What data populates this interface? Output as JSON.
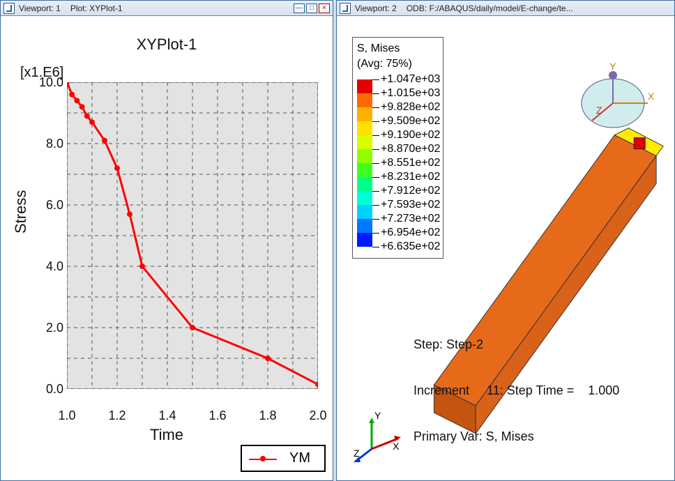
{
  "viewport1": {
    "title_label": "Viewport: 1",
    "title_extra_label": "Plot:",
    "title_extra_value": "XYPlot-1"
  },
  "viewport2": {
    "title_label": "Viewport: 2",
    "title_extra_label": "ODB:",
    "title_extra_value": "F:/ABAQUS/daily/model/E-change/te..."
  },
  "chart": {
    "title": "XYPlot-1",
    "scale_label": "[x1.E6]",
    "ylabel": "Stress",
    "xlabel": "Time",
    "legend": {
      "label": "YM"
    }
  },
  "chart_data": {
    "type": "line",
    "title": "XYPlot-1",
    "xlabel": "Time",
    "ylabel": "Stress",
    "y_scale_note": "[x1.E6]",
    "xlim": [
      1.0,
      2.0
    ],
    "ylim": [
      0.0,
      10.0
    ],
    "xticks": [
      1.0,
      1.2,
      1.4,
      1.6,
      1.8,
      2.0
    ],
    "ytick_labels": [
      "10.0",
      "8.0",
      "6.0",
      "4.0",
      "2.0",
      "0.0"
    ],
    "yticks": [
      10.0,
      8.0,
      6.0,
      4.0,
      2.0,
      0.0
    ],
    "series": [
      {
        "name": "YM",
        "color": "#ff0000",
        "x": [
          1.0,
          1.02,
          1.04,
          1.06,
          1.08,
          1.1,
          1.15,
          1.2,
          1.25,
          1.3,
          1.5,
          1.8,
          2.0
        ],
        "y": [
          10.0,
          9.6,
          9.4,
          9.2,
          8.9,
          8.7,
          8.1,
          7.2,
          5.7,
          4.0,
          2.0,
          1.0,
          0.15
        ]
      }
    ]
  },
  "mises": {
    "header1": "S, Mises",
    "header2": "(Avg: 75%)",
    "colors": [
      "#e40000",
      "#ff6a00",
      "#ffb000",
      "#ffe000",
      "#d7ff00",
      "#8fff00",
      "#40ff20",
      "#00ff88",
      "#00ffd8",
      "#00d0ff",
      "#0078ff",
      "#001aff"
    ],
    "values": [
      "+1.047e+03",
      "+1.015e+03",
      "+9.828e+02",
      "+9.509e+02",
      "+9.190e+02",
      "+8.870e+02",
      "+8.551e+02",
      "+8.231e+02",
      "+7.912e+02",
      "+7.593e+02",
      "+7.273e+02",
      "+6.954e+02",
      "+6.635e+02"
    ]
  },
  "step": {
    "line1": "Step: Step-2",
    "line2": "Increment     11: Step Time =    1.000",
    "line3": "Primary Var: S, Mises"
  },
  "triad": {
    "x": "X",
    "y": "Y",
    "z": "Z"
  },
  "mini_triad": {
    "x": "X",
    "y": "Y",
    "z": "Z"
  }
}
